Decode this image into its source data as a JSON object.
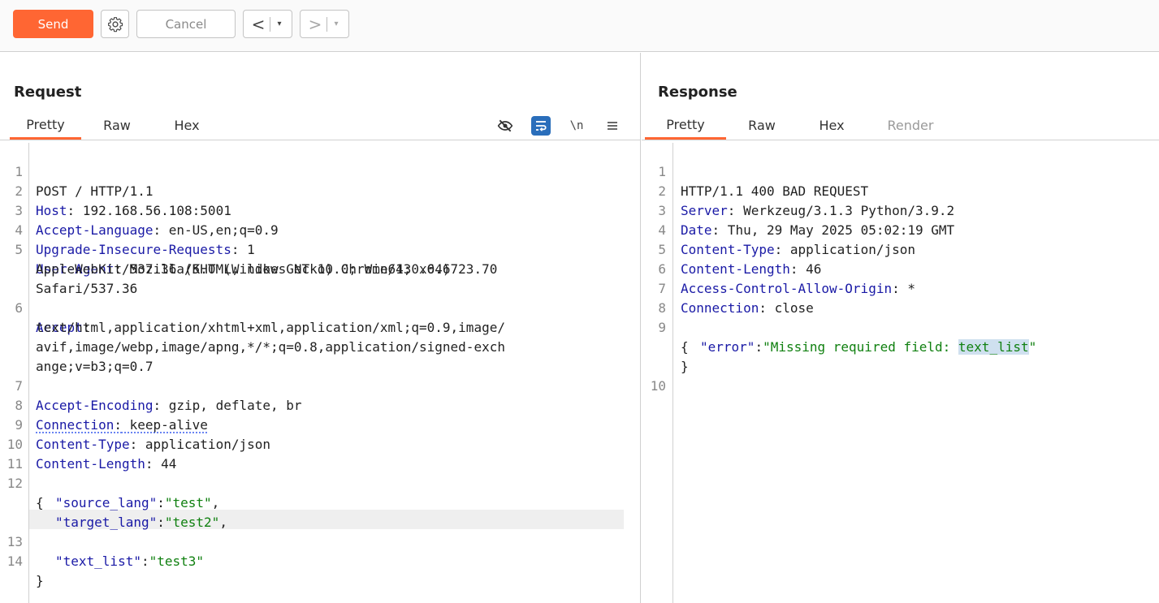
{
  "toolbar": {
    "send_label": "Send",
    "cancel_label": "Cancel",
    "back_arrow": "<",
    "forward_arrow": ">",
    "dropdown_glyph": "▾",
    "gear_icon": "gear-icon"
  },
  "request": {
    "title": "Request",
    "tabs": [
      "Pretty",
      "Raw",
      "Hex"
    ],
    "active_tab": "Pretty",
    "tools": {
      "newline_label": "\\n"
    },
    "lines": {
      "l1": {
        "n": "1",
        "text": "POST / HTTP/1.1"
      },
      "l2": {
        "n": "2",
        "key": "Host",
        "value": " 192.168.56.108:5001"
      },
      "l3": {
        "n": "3",
        "key": "Accept-Language",
        "value": " en-US,en;q=0.9"
      },
      "l4": {
        "n": "4",
        "key": "Upgrade-Insecure-Requests",
        "value": " 1"
      },
      "l5": {
        "n": "5",
        "key": "User-Agent",
        "value": " Mozilla/5.0 (Windows NT 10.0; Win64; x64)"
      },
      "l5b": "AppleWebKit/537.36 (KHTML, like Gecko) Chrome/130.0.6723.70",
      "l5c": "Safari/537.36",
      "l6": {
        "n": "6",
        "key": "Accept",
        "value": ""
      },
      "l6b": "text/html,application/xhtml+xml,application/xml;q=0.9,image/",
      "l6c": "avif,image/webp,image/apng,*/*;q=0.8,application/signed-exch",
      "l6d": "ange;v=b3;q=0.7",
      "l7": {
        "n": "7",
        "key": "Accept-Encoding",
        "value": " gzip, deflate, br"
      },
      "l8": {
        "n": "8",
        "key": "Connection",
        "value": " keep-alive"
      },
      "l9": {
        "n": "9",
        "key": "Content-Type",
        "value": " application/json"
      },
      "l10": {
        "n": "10",
        "key": "Content-Length",
        "value": " 44"
      },
      "l11": {
        "n": "11"
      },
      "l12": {
        "n": "12",
        "text": "{"
      },
      "l12b": {
        "key": "\"source_lang\"",
        "sep": ":",
        "value": "\"test\"",
        "trail": ","
      },
      "l12c": {
        "key": "\"target_lang\"",
        "sep": ":",
        "value": "\"test2\"",
        "trail": ","
      },
      "l13": {
        "n": "13",
        "key": "\"text_list\"",
        "sep": ":",
        "value": "\"test3\""
      },
      "l14": {
        "n": "14",
        "text": "}"
      }
    }
  },
  "response": {
    "title": "Response",
    "tabs": [
      "Pretty",
      "Raw",
      "Hex",
      "Render"
    ],
    "active_tab": "Pretty",
    "lines": {
      "l1": {
        "n": "1",
        "text": "HTTP/1.1 400 BAD REQUEST"
      },
      "l2": {
        "n": "2",
        "key": "Server",
        "value": " Werkzeug/3.1.3 Python/3.9.2"
      },
      "l3": {
        "n": "3",
        "key": "Date",
        "value": " Thu, 29 May 2025 05:02:19 GMT"
      },
      "l4": {
        "n": "4",
        "key": "Content-Type",
        "value": " application/json"
      },
      "l5": {
        "n": "5",
        "key": "Content-Length",
        "value": " 46"
      },
      "l6": {
        "n": "6",
        "key": "Access-Control-Allow-Origin",
        "value": " *"
      },
      "l7": {
        "n": "7",
        "key": "Connection",
        "value": " close"
      },
      "l8": {
        "n": "8"
      },
      "l9": {
        "n": "9",
        "text": "{"
      },
      "l9b": {
        "key": "\"error\"",
        "sep": ":",
        "value_pre": "\"Missing required field: ",
        "value_sel": "text_list",
        "value_post": "\""
      },
      "l9c": "}",
      "l10": {
        "n": "10"
      }
    }
  },
  "colors": {
    "accent": "#ff6633",
    "header_key": "#1a1aa6",
    "string": "#108010"
  }
}
